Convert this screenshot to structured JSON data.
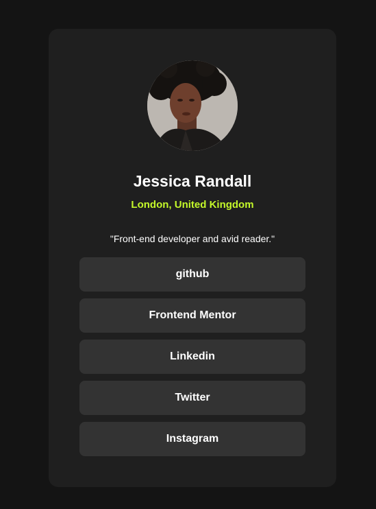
{
  "profile": {
    "name": "Jessica Randall",
    "location": "London, United Kingdom",
    "bio": "\"Front-end developer and avid reader.\""
  },
  "links": [
    {
      "label": "github"
    },
    {
      "label": "Frontend Mentor"
    },
    {
      "label": "Linkedin"
    },
    {
      "label": "Twitter"
    },
    {
      "label": "Instagram"
    }
  ],
  "colors": {
    "page_background": "#141414",
    "card_background": "#1f1f1f",
    "button_background": "#333333",
    "accent": "#c4f82a",
    "text": "#ffffff"
  },
  "icons": {
    "avatar": "profile-photo"
  }
}
